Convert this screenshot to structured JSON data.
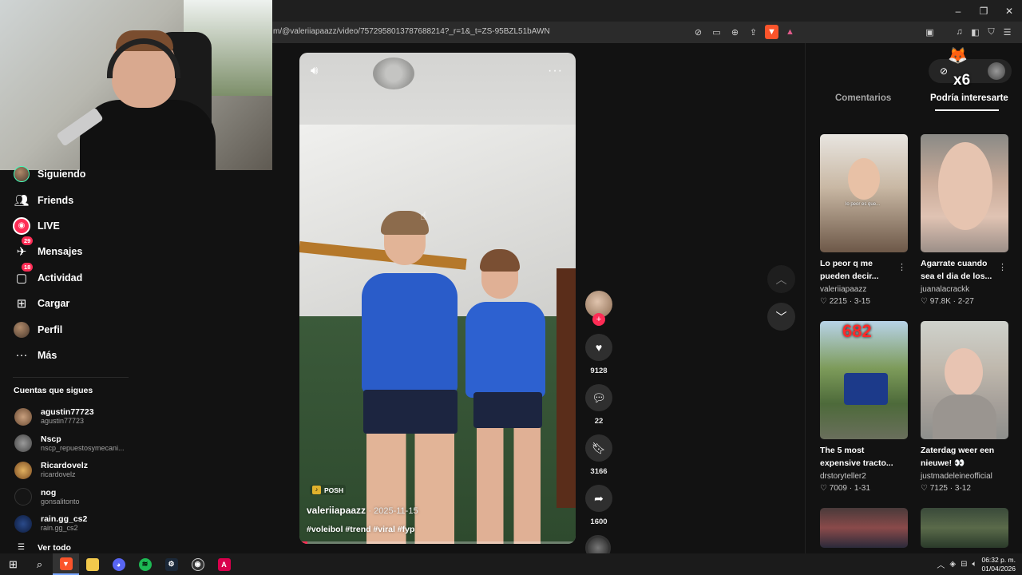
{
  "browser": {
    "url": "m/@valeriiapaazz/video/7572958013787688214?_r=1&_t=ZS-95BZL51bAWN",
    "window_controls": {
      "minimize": "–",
      "restore": "❐",
      "close": "✕"
    }
  },
  "sidebar": {
    "nav": [
      {
        "label": "Siguiendo",
        "icon": "following-avatar-icon"
      },
      {
        "label": "Friends",
        "icon": "friends-icon"
      },
      {
        "label": "LIVE",
        "icon": "live-icon"
      },
      {
        "label": "Mensajes",
        "icon": "messages-icon",
        "badge": "29"
      },
      {
        "label": "Actividad",
        "icon": "activity-icon",
        "badge": "18"
      },
      {
        "label": "Cargar",
        "icon": "upload-icon"
      },
      {
        "label": "Perfil",
        "icon": "profile-avatar-icon"
      },
      {
        "label": "Más",
        "icon": "more-icon"
      }
    ],
    "following_title": "Cuentas que sigues",
    "accounts": [
      {
        "name": "agustin77723",
        "handle": "agustin77723",
        "color": "#a67c5b"
      },
      {
        "name": "Nscp",
        "handle": "nscp_repuestosymecani...",
        "color": "#6a6a6a"
      },
      {
        "name": "Ricardovelz",
        "handle": "ricardovelz",
        "color": "#c48a3c"
      },
      {
        "name": "nog",
        "handle": "gonsalitonto",
        "color": "#151515"
      },
      {
        "name": "rain.gg_cs2",
        "handle": "rain.gg_cs2",
        "color": "#0d1a3a"
      }
    ],
    "see_all": "Ver todo"
  },
  "video": {
    "music_label": "POSH",
    "author": "valeriiapaazz",
    "date": "· 2025-11-15",
    "tags": "#voleibol #trend #viral #fyp",
    "progress": 0.03
  },
  "actions": {
    "likes": "9128",
    "comments": "22",
    "saves": "3166",
    "shares": "1600"
  },
  "right_panel": {
    "tab_comments": "Comentarios",
    "tab_related": "Podría interesarte",
    "overlay_multiplier": "x6",
    "cards": [
      {
        "title": "Lo peor q me pueden decir...",
        "author": "valeriiapaazz",
        "stats": "♡ 2215 · 3-15",
        "caption": "lo peor es que..."
      },
      {
        "title": "Agarrate cuando sea el dia de los...",
        "author": "juanalacrackk",
        "stats": "♡ 97.8K · 2-27",
        "caption": ""
      },
      {
        "title": "The 5 most expensive tracto...",
        "author": "drstoryteller2",
        "stats": "♡ 7009 · 1-31",
        "caption": "682"
      },
      {
        "title": "Zaterdag weer een nieuwe! 👀",
        "author": "justmadeleineofficial",
        "stats": "♡ 7125 · 3-12",
        "caption": ""
      },
      {
        "title": "",
        "author": "",
        "stats": "",
        "caption": ""
      },
      {
        "title": "",
        "author": "",
        "stats": "",
        "caption": ""
      }
    ]
  },
  "taskbar": {
    "time": "06:32 p. m.",
    "date": "01/04/2026"
  }
}
